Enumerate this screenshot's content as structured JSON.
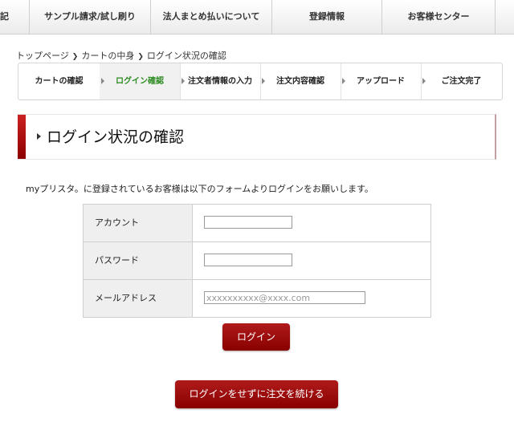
{
  "topnav": {
    "items": [
      "記",
      "サンプル請求/試し刷り",
      "法人まとめ払いについて",
      "登録情報",
      "お客様センター"
    ]
  },
  "breadcrumb": [
    "トップページ",
    "カートの中身",
    "ログイン状況の確認"
  ],
  "steps": [
    {
      "label": "カートの確認",
      "active": false
    },
    {
      "label": "ログイン確認",
      "active": true
    },
    {
      "label": "注文者情報の入力",
      "active": false
    },
    {
      "label": "注文内容確認",
      "active": false
    },
    {
      "label": "アップロード",
      "active": false
    },
    {
      "label": "ご注文完了",
      "active": false
    }
  ],
  "heading": "ログイン状況の確認",
  "intro": "myプリスタ。に登録されているお客様は以下のフォームよりログインをお願いします。",
  "form": {
    "account_label": "アカウント",
    "account_value": "",
    "password_label": "パスワード",
    "password_value": "",
    "email_label": "メールアドレス",
    "email_value": "",
    "email_placeholder": "xxxxxxxxxx@xxxx.com"
  },
  "buttons": {
    "login": "ログイン",
    "guest": "ログインをせずに注文を続ける"
  },
  "colors": {
    "accent": "#9b0f0f",
    "active_step_text": "#2a8a1f"
  }
}
